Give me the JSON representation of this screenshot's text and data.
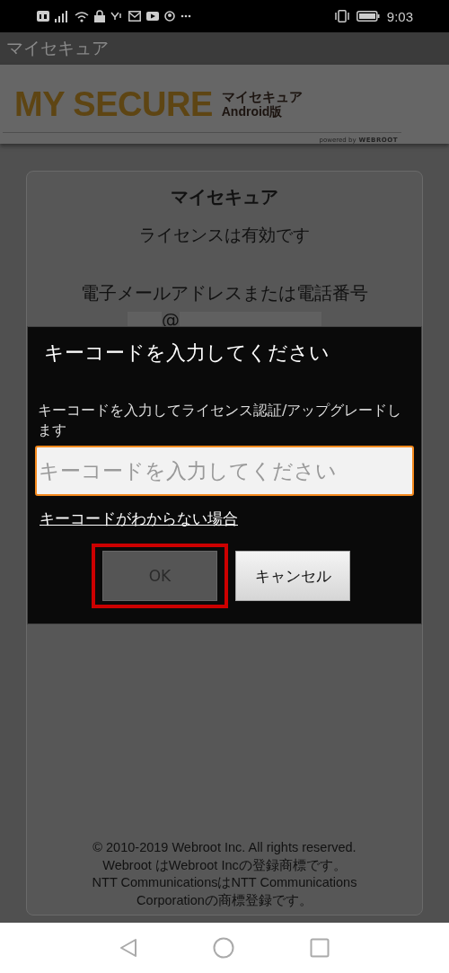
{
  "status_bar": {
    "time": "9:03"
  },
  "app_bar": {
    "title": "マイセキュア"
  },
  "banner": {
    "logo": "MY SECURE",
    "logo_sub_1": "マイセキュア",
    "logo_sub_2": "Android版",
    "powered_by": "powered by",
    "brand": "WEBROOT"
  },
  "card": {
    "title": "マイセキュア",
    "license_status": "ライセンスは有効です",
    "account_label": "電子メールアドレスまたは電話番号",
    "account_at": "@"
  },
  "dialog": {
    "title": "キーコードを入力してください",
    "message": "キーコードを入力してライセンス認証/アップグレードします",
    "field": {
      "placeholder": "キーコードを入力してください",
      "focused": true
    },
    "link": "キーコードがわからない場合",
    "buttons": [
      {
        "label": "OK",
        "disabled": true,
        "highlighted": true
      },
      {
        "label": "キャンセル",
        "disabled": false,
        "highlighted": false
      }
    ]
  },
  "footer": [
    "© 2010-2019 Webroot Inc. All rights reserved.",
    "Webroot はWebroot Incの登録商標です。",
    "NTT CommunicationsはNTT Communications",
    "Corporationの商標登録です。"
  ]
}
